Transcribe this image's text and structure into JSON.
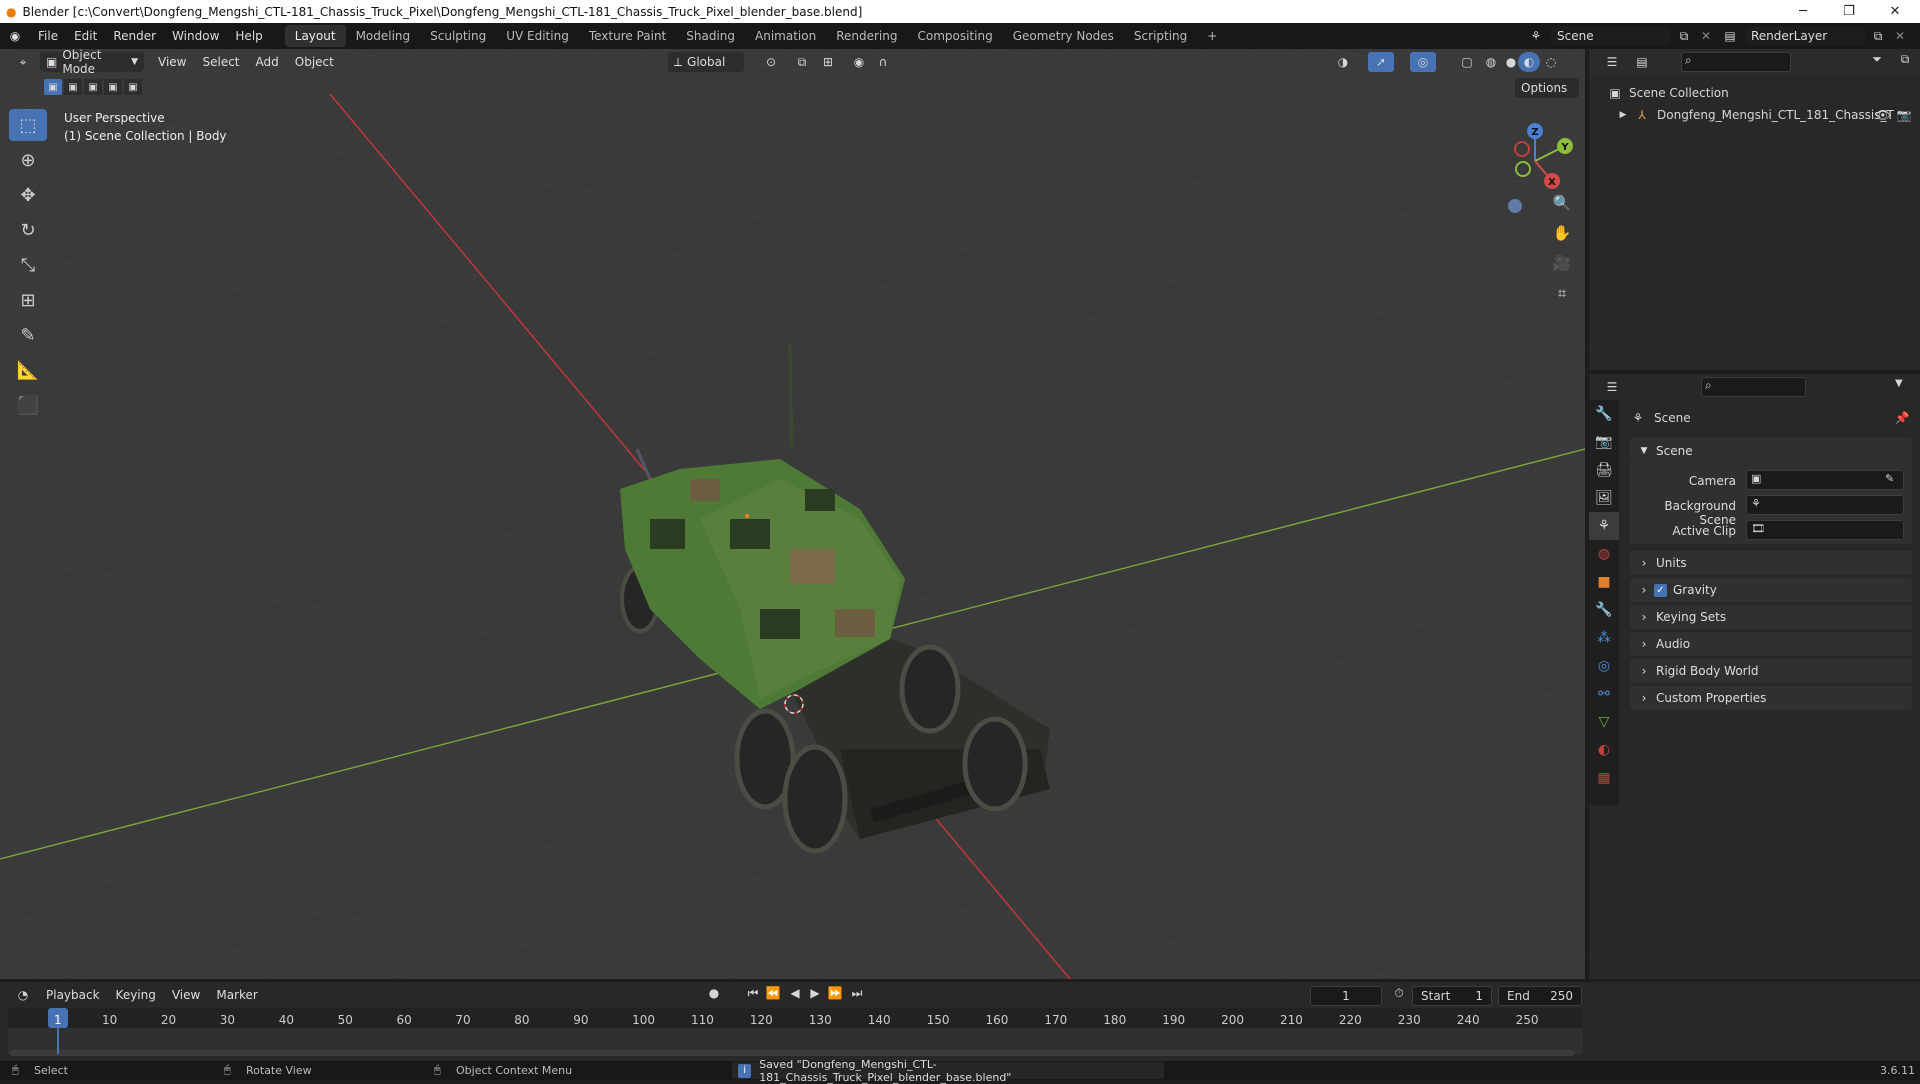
{
  "window": {
    "title": "Blender [c:\\Convert\\Dongfeng_Mengshi_CTL-181_Chassis_Truck_Pixel\\Dongfeng_Mengshi_CTL-181_Chassis_Truck_Pixel_blender_base.blend]"
  },
  "menus": [
    "File",
    "Edit",
    "Render",
    "Window",
    "Help"
  ],
  "workspaces": [
    "Layout",
    "Modeling",
    "Sculpting",
    "UV Editing",
    "Texture Paint",
    "Shading",
    "Animation",
    "Rendering",
    "Compositing",
    "Geometry Nodes",
    "Scripting"
  ],
  "active_workspace": "Layout",
  "scene_selector": "Scene",
  "renderlayer_selector": "RenderLayer",
  "viewport": {
    "mode": "Object Mode",
    "menus": [
      "View",
      "Select",
      "Add",
      "Object"
    ],
    "orientation": "Global",
    "options_label": "Options",
    "overlay_line1": "User Perspective",
    "overlay_line2": "(1) Scene Collection | Body",
    "gizmo_labels": {
      "z": "Z",
      "y": "Y",
      "x": "X"
    }
  },
  "outliner": {
    "root": "Scene Collection",
    "items": [
      {
        "label": "Dongfeng_Mengshi_CTL_181_Chassis_T"
      }
    ]
  },
  "properties": {
    "header": "Scene",
    "panel_scene": "Scene",
    "camera_label": "Camera",
    "background_label": "Background Scene",
    "clip_label": "Active Clip",
    "panels": [
      "Units",
      "Gravity",
      "Keying Sets",
      "Audio",
      "Rigid Body World",
      "Custom Properties"
    ],
    "gravity_checked": true
  },
  "timeline": {
    "menus": [
      "Playback",
      "Keying",
      "View",
      "Marker"
    ],
    "current_frame": "1",
    "start_label": "Start",
    "start_value": "1",
    "end_label": "End",
    "end_value": "250",
    "ticks": [
      "1",
      "10",
      "20",
      "30",
      "40",
      "50",
      "60",
      "70",
      "80",
      "90",
      "100",
      "110",
      "120",
      "130",
      "140",
      "150",
      "160",
      "170",
      "180",
      "190",
      "200",
      "210",
      "220",
      "230",
      "240",
      "250"
    ]
  },
  "statusbar": {
    "select": "Select",
    "rotate": "Rotate View",
    "context": "Object Context Menu",
    "message": "Saved \"Dongfeng_Mengshi_CTL-181_Chassis_Truck_Pixel_blender_base.blend\"",
    "version": "3.6.11"
  },
  "colors": {
    "accent": "#4772b3",
    "x_axis": "#c8363c",
    "y_axis": "#8cbc3c",
    "camo_green": "#4e7a36"
  }
}
